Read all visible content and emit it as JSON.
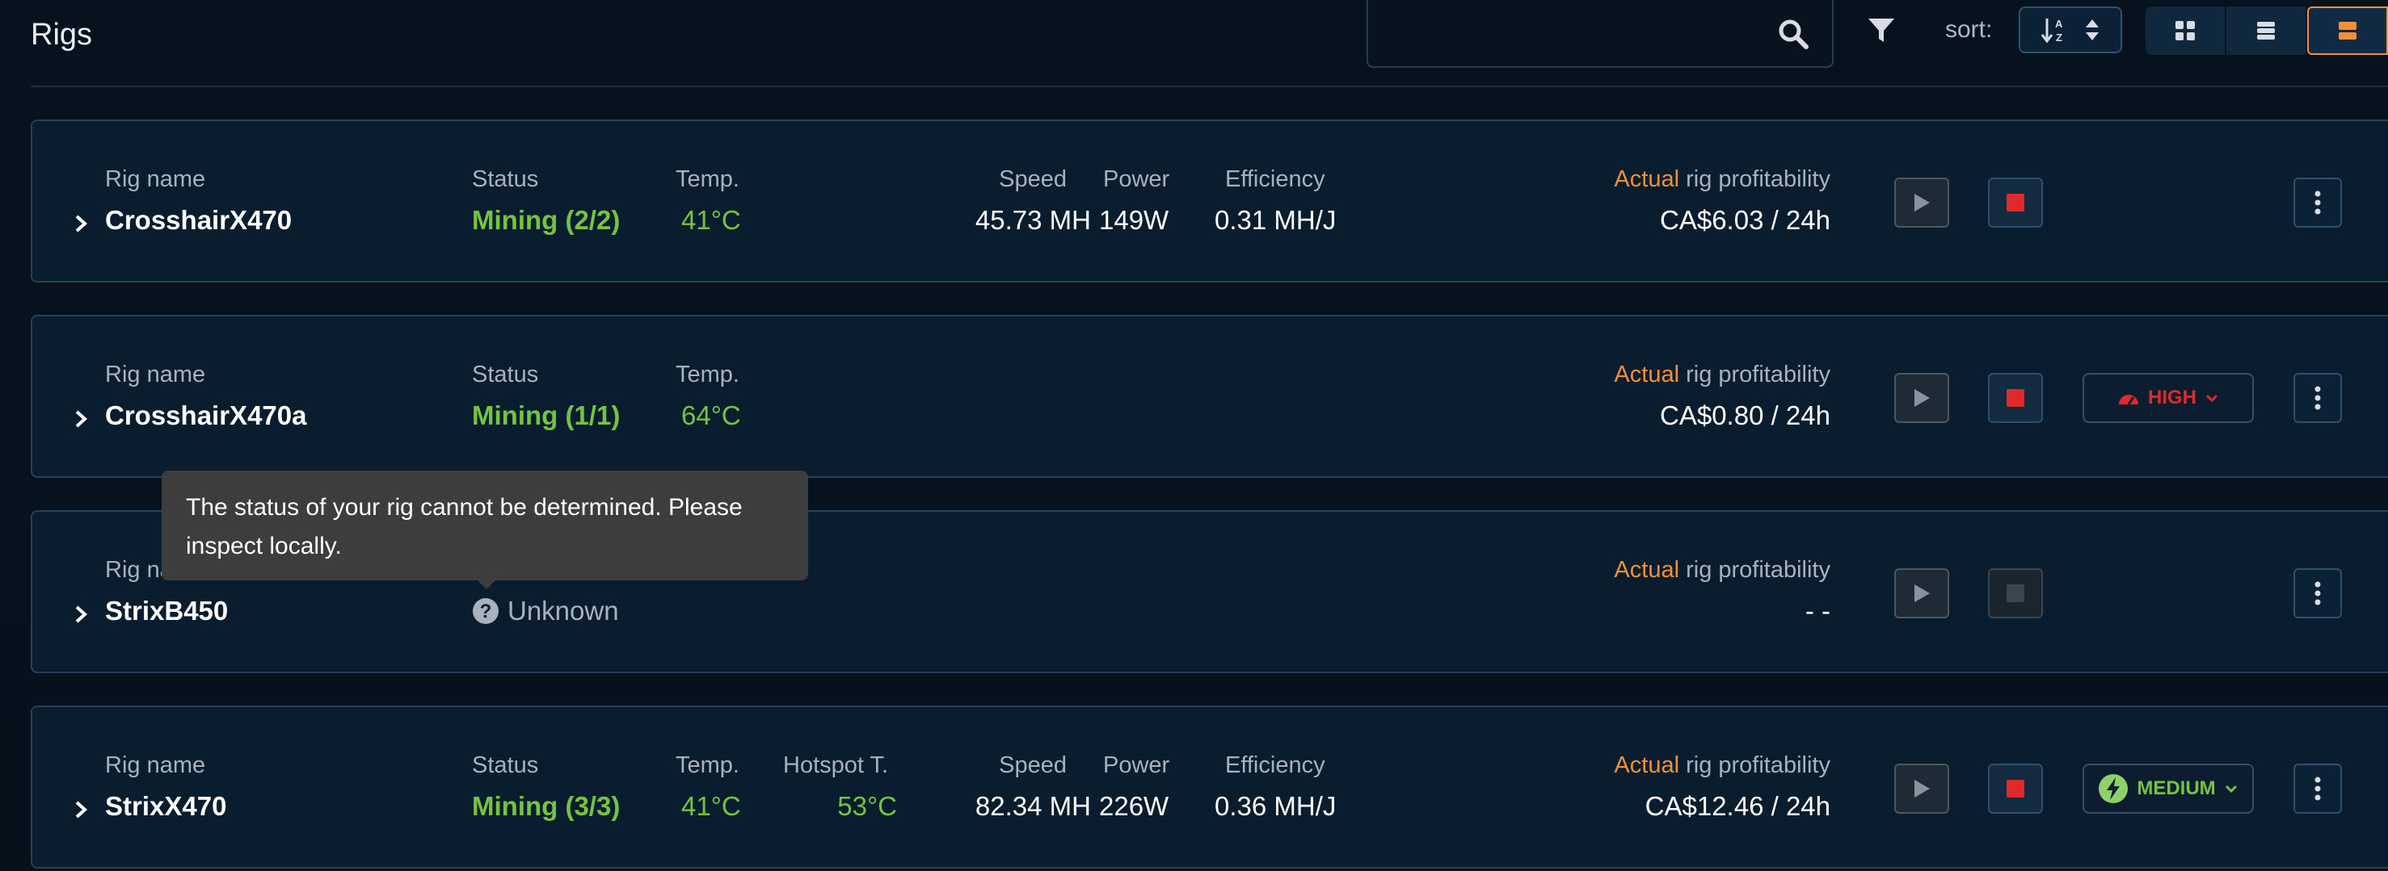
{
  "header": {
    "title": "Rigs",
    "search_placeholder": "",
    "sort_label": "sort:",
    "views": [
      "grid-view-icon",
      "list-view-icon",
      "detail-view-icon"
    ]
  },
  "labels": {
    "rig_name": "Rig name",
    "status": "Status",
    "temp": "Temp.",
    "hotspot": "Hotspot T.",
    "speed": "Speed",
    "power": "Power",
    "efficiency": "Efficiency",
    "actual": "Actual",
    "profitability": " rig profitability"
  },
  "rigs": [
    {
      "name": "CrosshairX470",
      "status": "Mining (2/2)",
      "temp": "41°C",
      "speed": "45.73 MH",
      "power": "149W",
      "efficiency": "0.31 MH/J",
      "profit": "CA$6.03 / 24h"
    },
    {
      "name": "CrosshairX470a",
      "status": "Mining (1/1)",
      "temp": "64°C",
      "profit": "CA$0.80 / 24h",
      "mode": "HIGH"
    },
    {
      "name": "StrixB450",
      "status": "Unknown",
      "profit": "- -"
    },
    {
      "name": "StrixX470",
      "status": "Mining (3/3)",
      "temp": "41°C",
      "hotspot": "53°C",
      "speed": "82.34 MH",
      "power": "226W",
      "efficiency": "0.36 MH/J",
      "profit": "CA$12.46 / 24h",
      "mode": "MEDIUM"
    }
  ],
  "tooltip": {
    "text": "The status of your rig cannot be determined. Please inspect locally."
  },
  "colors": {
    "accent_orange": "#f0913a",
    "mining_green": "#74c442",
    "stop_red": "#e02a2a"
  }
}
